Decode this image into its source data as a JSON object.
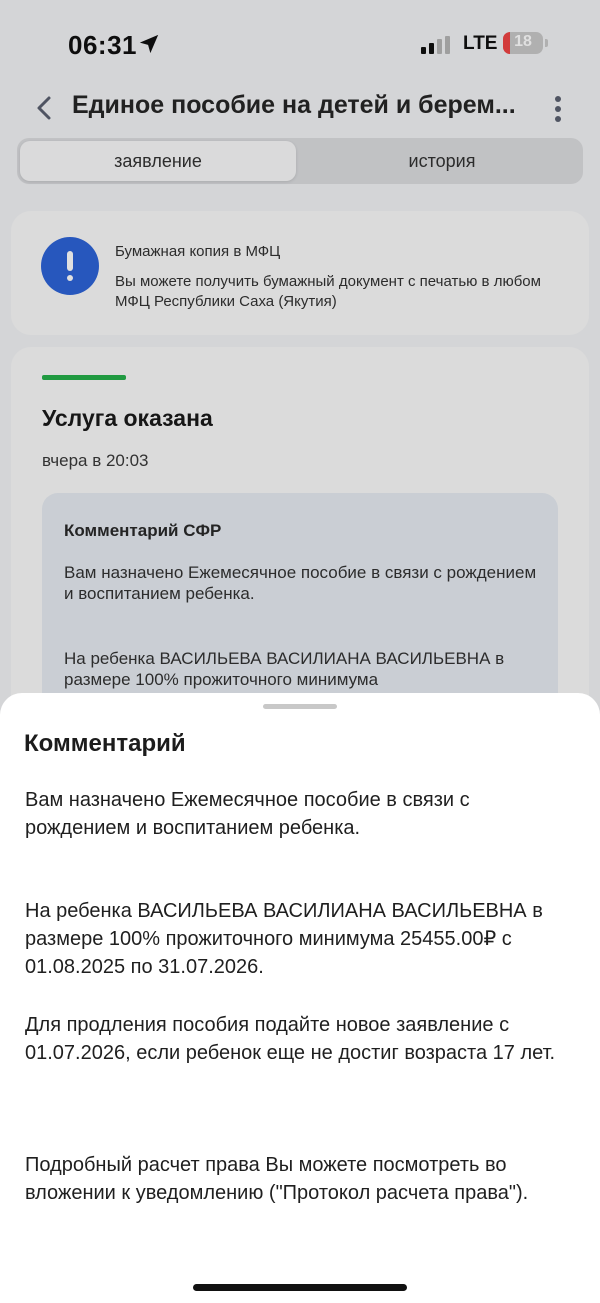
{
  "status_bar": {
    "time": "06:31",
    "network": "LTE",
    "battery": "18",
    "battery_level": 0.18,
    "signal_bars_active": 2,
    "signal_bars_total": 4
  },
  "header": {
    "title": "Единое пособие на детей и берем...",
    "back_icon": "chevron-left-icon",
    "menu_icon": "more-vertical-icon"
  },
  "tabs": [
    {
      "label": "заявление",
      "active": true
    },
    {
      "label": "история",
      "active": false
    }
  ],
  "info_card": {
    "icon": "info-icon",
    "title": "Бумажная копия в МФЦ",
    "text": "Вы можете получить бумажный документ с печатью в любом МФЦ Республики Саха (Якутия)"
  },
  "status_card": {
    "status": "Услуга оказана",
    "time": "вчера в 20:03",
    "comment_title": "Комментарий СФР",
    "comment_p1": "Вам назначено Ежемесячное пособие в связи с рождением и воспитанием ребенка.",
    "comment_p2": "На ребенка ВАСИЛЬЕВА ВАСИЛИАНА ВАСИЛЬЕВНА в размере 100% прожиточного минимума"
  },
  "sheet": {
    "title": "Комментарий",
    "paragraphs": [
      "Вам назначено Ежемесячное пособие в связи с рождением и воспитанием ребенка.",
      "На ребенка ВАСИЛЬЕВА ВАСИЛИАНА ВАСИЛЬЕВНА в размере 100% прожиточного минимума 25455.00₽ с 01.08.2025 по 31.07.2026.",
      "Для продления пособия подайте новое заявление с 01.07.2026, если ребенок еще не достиг возраста 17 лет.",
      "Подробный расчет права Вы можете посмотреть во вложении к уведомлению (\"Протокол расчета права\")."
    ]
  },
  "colors": {
    "accent": "#2d63d8",
    "success": "#25b04a",
    "battery_low": "#ef4444"
  }
}
